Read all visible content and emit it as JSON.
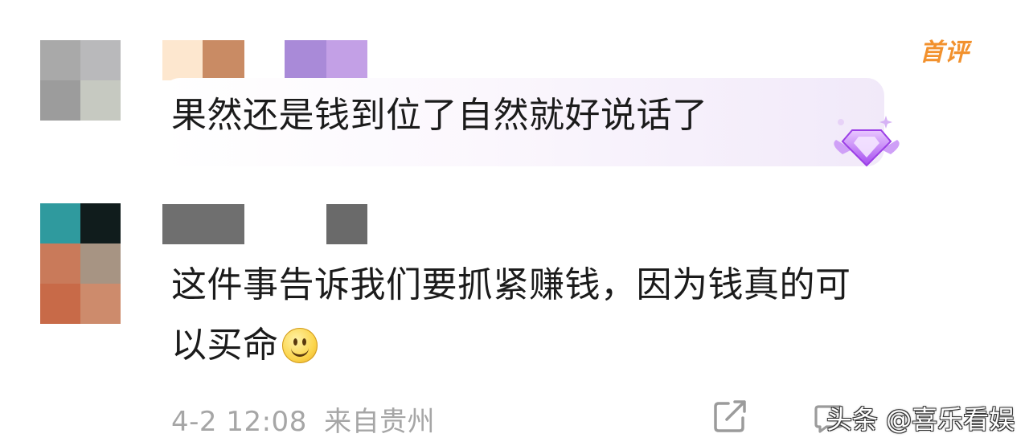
{
  "colors": {
    "background": "#ffffff",
    "text": "#1b1b1b",
    "meta": "#a6a6a6",
    "first_badge": "#f2912d",
    "bubble_tint": "#f1e9f9"
  },
  "comments": [
    {
      "avatar": "blurred-avatar",
      "name": "",
      "badge": "首评",
      "text": "果然还是钱到位了自然就好说话了",
      "decoration": "purple-gem-icon"
    },
    {
      "avatar": "blurred-avatar",
      "name": "",
      "text_line1": "这件事告诉我们要抓紧赚钱，因为钱真的可",
      "text_line2": "以买命",
      "emoji": "smile-emoji",
      "meta": {
        "time": "4-2 12:08",
        "location": "来自贵州"
      }
    }
  ],
  "actions": {
    "share_icon": "share-icon",
    "reply_icon": "comment-icon"
  },
  "watermark": "头条 @喜乐看娱"
}
